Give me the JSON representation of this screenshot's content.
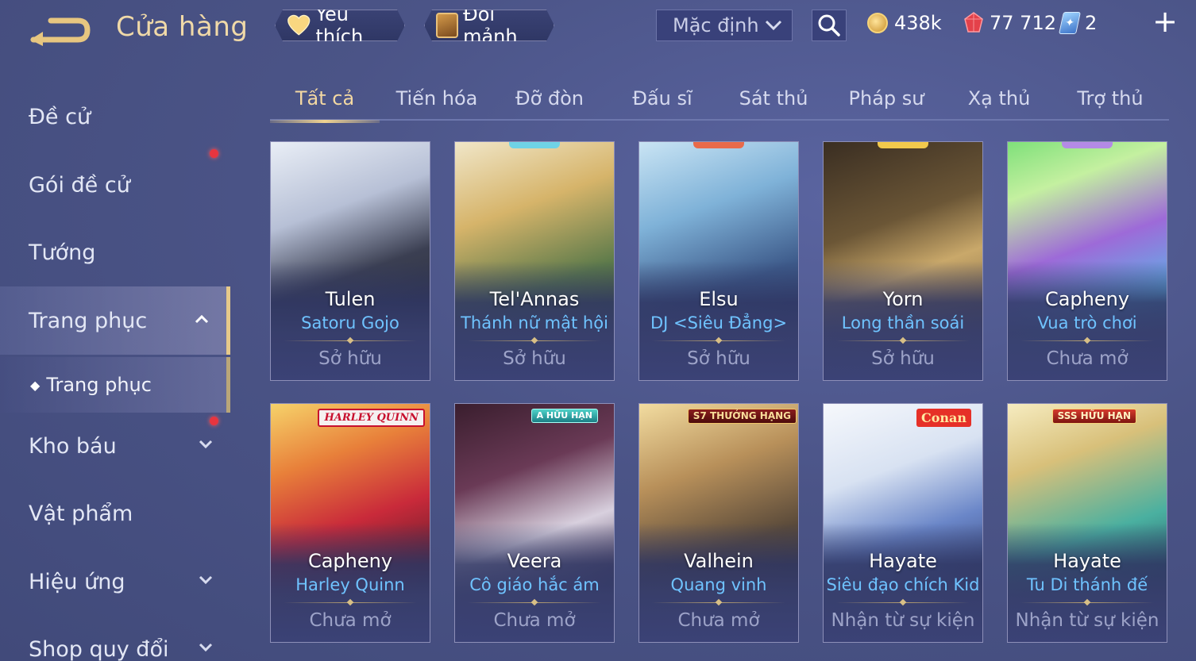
{
  "header": {
    "title": "Cửa hàng",
    "favorites_label": "Yêu thích",
    "shard_exchange_label": "Đổi mảnh",
    "sort_value": "Mặc định"
  },
  "currencies": {
    "gold": "438k",
    "ruby": "77 712",
    "voucher": "2"
  },
  "sidebar": {
    "items": [
      {
        "label": "Đề cử"
      },
      {
        "label": "Gói đề cử"
      },
      {
        "label": "Tướng"
      },
      {
        "label": "Trang phục"
      },
      {
        "label": "Kho báu"
      },
      {
        "label": "Vật phẩm"
      },
      {
        "label": "Hiệu ứng"
      },
      {
        "label": "Shop quy đổi"
      }
    ],
    "sub_item": "Trang phục"
  },
  "tabs": [
    "Tất cả",
    "Tiến hóa",
    "Đỡ đòn",
    "Đấu sĩ",
    "Sát thủ",
    "Pháp sư",
    "Xạ thủ",
    "Trợ thủ"
  ],
  "cards": [
    {
      "hero": "Tulen",
      "skin": "Satoru Gojo",
      "status": "Sở hữu"
    },
    {
      "hero": "Tel'Annas",
      "skin": "Thánh nữ mật hội",
      "status": "Sở hữu"
    },
    {
      "hero": "Elsu",
      "skin": "DJ <Siêu Đẳng>",
      "status": "Sở hữu"
    },
    {
      "hero": "Yorn",
      "skin": "Long thần soái",
      "status": "Sở hữu"
    },
    {
      "hero": "Capheny",
      "skin": "Vua trò chơi",
      "status": "Chưa mở"
    },
    {
      "hero": "Capheny",
      "skin": "Harley Quinn",
      "status": "Chưa mở",
      "badge": "HARLEY QUINN"
    },
    {
      "hero": "Veera",
      "skin": "Cô giáo hắc ám",
      "status": "Chưa mở",
      "badge": "A HỮU HẠN"
    },
    {
      "hero": "Valhein",
      "skin": "Quang vinh",
      "status": "Chưa mở",
      "badge": "S7 THƯỞNG HẠNG"
    },
    {
      "hero": "Hayate",
      "skin": "Siêu đạo chích Kid",
      "status": "Nhận từ sự kiện",
      "badge": "Conan"
    },
    {
      "hero": "Hayate",
      "skin": "Tu Di thánh đế",
      "status": "Nhận từ sự kiện",
      "badge": "SSS HỮU HẠN"
    }
  ],
  "colors": {
    "background": "#4b5487",
    "accent_gold": "#f0d9a8",
    "skin_name": "#6fc3ff",
    "notification_dot": "#e8353f"
  }
}
